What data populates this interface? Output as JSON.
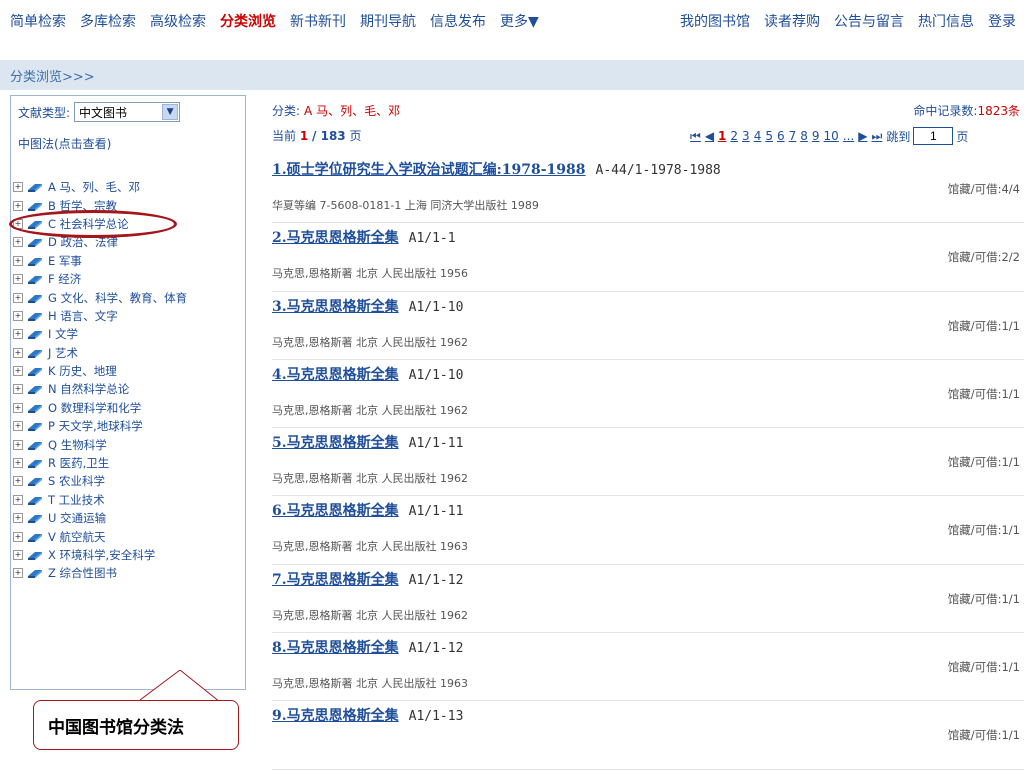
{
  "nav": {
    "left": [
      "简单检索",
      "多库检索",
      "高级检索",
      "分类浏览",
      "新书新刊",
      "期刊导航",
      "信息发布",
      "更多▼"
    ],
    "active_index": 3,
    "right": [
      "我的图书馆",
      "读者荐购",
      "公告与留言",
      "热门信息",
      "登录"
    ]
  },
  "breadcrumb": "分类浏览>>>",
  "sidebar": {
    "doc_type_label": "文献类型:",
    "doc_type_value": "中文图书",
    "clc_link": "中图法(点击查看)",
    "tree": [
      "A 马、列、毛、邓",
      "B 哲学、宗教",
      "C 社会科学总论",
      "D 政治、法律",
      "E 军事",
      "F 经济",
      "G 文化、科学、教育、体育",
      "H 语言、文字",
      "I 文学",
      "J 艺术",
      "K 历史、地理",
      "N 自然科学总论",
      "O 数理科学和化学",
      "P 天文学,地球科学",
      "Q 生物科学",
      "R 医药,卫生",
      "S 农业科学",
      "T 工业技术",
      "U 交通运输",
      "V 航空航天",
      "X 环境科学,安全科学",
      "Z 综合性图书"
    ],
    "highlight_index": 2
  },
  "callout": "中国图书馆分类法",
  "main": {
    "category_label": "分类:",
    "category_value": "A 马、列、毛、邓",
    "hits_label": "命中记录数:",
    "hits_value": "1823条",
    "current_label": "当前",
    "current_page": "1",
    "total_pages": "/ 183",
    "page_unit": "页",
    "pager": {
      "first": "⏮",
      "prev": "◀",
      "pages": [
        "1",
        "2",
        "3",
        "4",
        "5",
        "6",
        "7",
        "8",
        "9",
        "10",
        "..."
      ],
      "next": "▶",
      "last": "⏭",
      "jump_label": "跳到",
      "jump_value": "1",
      "jump_unit": "页"
    }
  },
  "results": [
    {
      "title": "1.硕士学位研究生入学政治试题汇编:1978-1988",
      "callno": "A-44/1-1978-1988",
      "pub": "华夏等编  7-5608-0181-1  上海  同济大学出版社  1989",
      "avail": "馆藏/可借:4/4"
    },
    {
      "title": "2.马克思恩格斯全集",
      "callno": "A1/1-1",
      "pub": "马克思,恩格斯著    北京  人民出版社  1956",
      "avail": "馆藏/可借:2/2"
    },
    {
      "title": "3.马克思恩格斯全集",
      "callno": "A1/1-10",
      "pub": "马克思,恩格斯著    北京  人民出版社  1962",
      "avail": "馆藏/可借:1/1"
    },
    {
      "title": "4.马克思恩格斯全集",
      "callno": "A1/1-10",
      "pub": "马克思,恩格斯著    北京  人民出版社  1962",
      "avail": "馆藏/可借:1/1"
    },
    {
      "title": "5.马克思恩格斯全集",
      "callno": "A1/1-11",
      "pub": "马克思,恩格斯著    北京  人民出版社  1962",
      "avail": "馆藏/可借:1/1"
    },
    {
      "title": "6.马克思恩格斯全集",
      "callno": "A1/1-11",
      "pub": "马克思,恩格斯著    北京  人民出版社  1963",
      "avail": "馆藏/可借:1/1"
    },
    {
      "title": "7.马克思恩格斯全集",
      "callno": "A1/1-12",
      "pub": "马克思,恩格斯著    北京  人民出版社  1962",
      "avail": "馆藏/可借:1/1"
    },
    {
      "title": "8.马克思恩格斯全集",
      "callno": "A1/1-12",
      "pub": "马克思,恩格斯著    北京  人民出版社  1963",
      "avail": "馆藏/可借:1/1"
    },
    {
      "title": "9.马克思恩格斯全集",
      "callno": "A1/1-13",
      "pub": "",
      "avail": "馆藏/可借:1/1"
    }
  ]
}
